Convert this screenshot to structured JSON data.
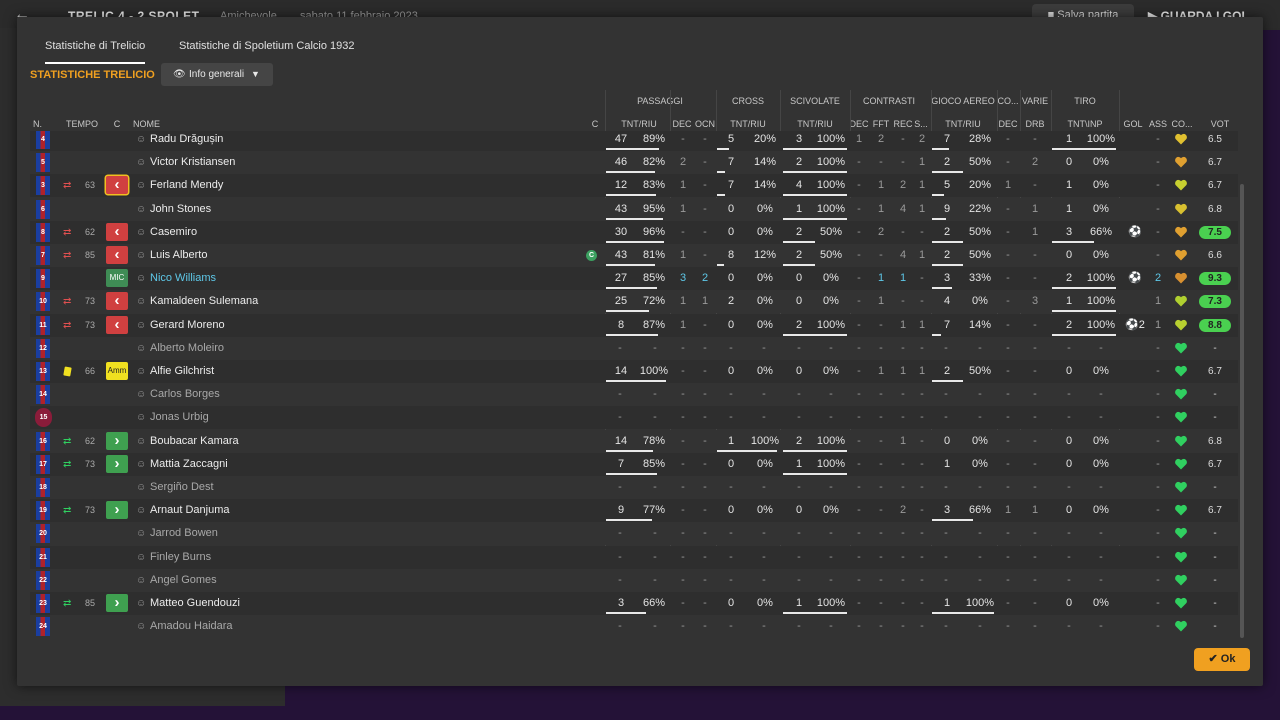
{
  "topbar": {
    "back_icon": "arrow-left-icon",
    "match": "TRELIC  4 - 2  SPOLET",
    "competition": "Amichevole",
    "date": "sabato 11 febbraio 2023",
    "save_label": "Salva partita",
    "watch_label": "GUARDA I GOL"
  },
  "tabs": [
    {
      "label": "Statistiche di Trelicio",
      "active": true
    },
    {
      "label": "Statistiche di Spoletium Calcio 1932",
      "active": false
    }
  ],
  "section_title": "STATISTICHE TRELICIO",
  "view_dropdown": {
    "label": "Info generali",
    "icon": "eye-icon"
  },
  "group_headers": [
    "PASSAGGI",
    "CROSS",
    "SCIVOLATE",
    "CONTRASTI",
    "GIOCO AEREO",
    "CO...",
    "VARIE",
    "TIRO"
  ],
  "column_headers": {
    "num": "N.",
    "time": "TEMPO",
    "c": "C",
    "name": "NOME",
    "c2": "C",
    "pass": "TNT/RIU",
    "dec": "DEC",
    "ocn": "OCN",
    "cross": "TNT/RIU",
    "tackle": "TNT/RIU",
    "cdec": "DEC",
    "fft": "FFT",
    "rec": "REC",
    "s": "S...",
    "aerial": "TNT/RIU",
    "codec": "DEC",
    "drb": "DRB",
    "shot": "TNT\\INP",
    "gol": "GOL",
    "ass": "ASS",
    "co": "CO...",
    "vot": "VOT"
  },
  "colors": {
    "accent": "#f0a020",
    "highlight": "#5ec8e8",
    "sub_out": "#d04040",
    "sub_in": "#3fa050"
  },
  "players": [
    {
      "num": "4",
      "name": "Radu Drăgușin",
      "status": "played",
      "sub": "",
      "min": "",
      "badge": "",
      "pass": [
        "47",
        "89%"
      ],
      "pass_frac": 0.89,
      "dec": "-",
      "ocn": "-",
      "cross": [
        "5",
        "20%"
      ],
      "cross_frac": 0.2,
      "tackle": [
        "3",
        "100%"
      ],
      "tackle_frac": 1,
      "cdec": "1",
      "fft": "2",
      "rec": "-",
      "s": "2",
      "aerial": [
        "7",
        "28%"
      ],
      "aerial_frac": 0.28,
      "codec": "-",
      "drb": "-",
      "shot": [
        "1",
        "100%"
      ],
      "shot_frac": 1,
      "gol": "",
      "ass": "-",
      "heart": "#e0c030",
      "rating": "6.5",
      "rating_style": "plain"
    },
    {
      "num": "5",
      "name": "Victor Kristiansen",
      "status": "played",
      "sub": "",
      "min": "",
      "badge": "",
      "pass": [
        "46",
        "82%"
      ],
      "pass_frac": 0.82,
      "dec": "2",
      "ocn": "-",
      "cross": [
        "7",
        "14%"
      ],
      "cross_frac": 0.14,
      "tackle": [
        "2",
        "100%"
      ],
      "tackle_frac": 1,
      "cdec": "-",
      "fft": "-",
      "rec": "-",
      "s": "1",
      "aerial": [
        "2",
        "50%"
      ],
      "aerial_frac": 0.5,
      "codec": "-",
      "drb": "2",
      "shot": [
        "0",
        "0%"
      ],
      "shot_frac": 0,
      "gol": "",
      "ass": "-",
      "heart": "#e0a030",
      "rating": "6.7",
      "rating_style": "plain"
    },
    {
      "num": "3",
      "name": "Ferland Mendy",
      "status": "played",
      "sub": "out",
      "min": "63",
      "badge": "red-sel",
      "pass": [
        "12",
        "83%"
      ],
      "pass_frac": 0.83,
      "dec": "1",
      "ocn": "-",
      "cross": [
        "7",
        "14%"
      ],
      "cross_frac": 0.14,
      "tackle": [
        "4",
        "100%"
      ],
      "tackle_frac": 1,
      "cdec": "-",
      "fft": "1",
      "rec": "2",
      "s": "1",
      "aerial": [
        "5",
        "20%"
      ],
      "aerial_frac": 0.2,
      "codec": "1",
      "drb": "-",
      "shot": [
        "1",
        "0%"
      ],
      "shot_frac": 0,
      "gol": "",
      "ass": "-",
      "heart": "#c8d030",
      "rating": "6.7",
      "rating_style": "plain"
    },
    {
      "num": "6",
      "name": "John Stones",
      "status": "played",
      "sub": "",
      "min": "",
      "badge": "",
      "pass": [
        "43",
        "95%"
      ],
      "pass_frac": 0.95,
      "dec": "1",
      "ocn": "-",
      "cross": [
        "0",
        "0%"
      ],
      "cross_frac": 0,
      "tackle": [
        "1",
        "100%"
      ],
      "tackle_frac": 1,
      "cdec": "-",
      "fft": "1",
      "rec": "4",
      "s": "1",
      "aerial": [
        "9",
        "22%"
      ],
      "aerial_frac": 0.22,
      "codec": "-",
      "drb": "1",
      "shot": [
        "1",
        "0%"
      ],
      "shot_frac": 0,
      "gol": "",
      "ass": "-",
      "heart": "#d8c030",
      "rating": "6.8",
      "rating_style": "plain"
    },
    {
      "num": "8",
      "name": "Casemiro",
      "status": "played",
      "sub": "out",
      "min": "62",
      "badge": "red",
      "pass": [
        "30",
        "96%"
      ],
      "pass_frac": 0.96,
      "dec": "-",
      "ocn": "-",
      "cross": [
        "0",
        "0%"
      ],
      "cross_frac": 0,
      "tackle": [
        "2",
        "50%"
      ],
      "tackle_frac": 0.5,
      "cdec": "-",
      "fft": "2",
      "rec": "-",
      "s": "-",
      "aerial": [
        "2",
        "50%"
      ],
      "aerial_frac": 0.5,
      "codec": "-",
      "drb": "1",
      "shot": [
        "3",
        "66%"
      ],
      "shot_frac": 0.66,
      "gol": "⚽",
      "ass": "-",
      "heart": "#e0a030",
      "rating": "7.5",
      "rating_style": "g2"
    },
    {
      "num": "7",
      "name": "Luis Alberto",
      "status": "played",
      "sub": "out",
      "min": "85",
      "badge": "red",
      "captain": true,
      "pass": [
        "43",
        "81%"
      ],
      "pass_frac": 0.81,
      "dec": "1",
      "ocn": "-",
      "cross": [
        "8",
        "12%"
      ],
      "cross_frac": 0.12,
      "tackle": [
        "2",
        "50%"
      ],
      "tackle_frac": 0.5,
      "cdec": "-",
      "fft": "-",
      "rec": "4",
      "s": "1",
      "aerial": [
        "2",
        "50%"
      ],
      "aerial_frac": 0.5,
      "codec": "-",
      "drb": "-",
      "shot": [
        "0",
        "0%"
      ],
      "shot_frac": 0,
      "gol": "",
      "ass": "-",
      "heart": "#e0a030",
      "rating": "6.6",
      "rating_style": "plain"
    },
    {
      "num": "9",
      "name": "Nico Williams",
      "status": "highlight",
      "sub": "",
      "min": "",
      "badge": "mic",
      "badge_text": "MIC",
      "pass": [
        "27",
        "85%"
      ],
      "pass_frac": 0.85,
      "dec": "3",
      "ocn": "2",
      "cross": [
        "0",
        "0%"
      ],
      "cross_frac": 0,
      "tackle": [
        "0",
        "0%"
      ],
      "tackle_frac": 0,
      "cdec": "-",
      "fft": "1",
      "rec": "1",
      "s": "-",
      "aerial": [
        "3",
        "33%"
      ],
      "aerial_frac": 0.33,
      "codec": "-",
      "drb": "-",
      "shot": [
        "2",
        "100%"
      ],
      "shot_frac": 1,
      "gol": "⚽",
      "ass": "2",
      "heart": "#d89030",
      "rating": "9.3",
      "rating_style": "g2"
    },
    {
      "num": "10",
      "name": "Kamaldeen Sulemana",
      "status": "played",
      "sub": "out",
      "min": "73",
      "badge": "red",
      "pass": [
        "25",
        "72%"
      ],
      "pass_frac": 0.72,
      "dec": "1",
      "ocn": "1",
      "cross": [
        "2",
        "0%"
      ],
      "cross_frac": 0,
      "tackle": [
        "0",
        "0%"
      ],
      "tackle_frac": 0,
      "cdec": "-",
      "fft": "1",
      "rec": "-",
      "s": "-",
      "aerial": [
        "4",
        "0%"
      ],
      "aerial_frac": 0,
      "codec": "-",
      "drb": "3",
      "shot": [
        "1",
        "100%"
      ],
      "shot_frac": 1,
      "gol": "",
      "ass": "1",
      "heart": "#b0d030",
      "rating": "7.3",
      "rating_style": "g2"
    },
    {
      "num": "11",
      "name": "Gerard Moreno",
      "status": "played",
      "sub": "out",
      "min": "73",
      "badge": "red",
      "pass": [
        "8",
        "87%"
      ],
      "pass_frac": 0.87,
      "dec": "1",
      "ocn": "-",
      "cross": [
        "0",
        "0%"
      ],
      "cross_frac": 0,
      "tackle": [
        "2",
        "100%"
      ],
      "tackle_frac": 1,
      "cdec": "-",
      "fft": "-",
      "rec": "1",
      "s": "1",
      "aerial": [
        "7",
        "14%"
      ],
      "aerial_frac": 0.14,
      "codec": "-",
      "drb": "-",
      "shot": [
        "2",
        "100%"
      ],
      "shot_frac": 1,
      "gol": "⚽2",
      "ass": "1",
      "heart": "#b8d030",
      "rating": "8.8",
      "rating_style": "g2"
    },
    {
      "num": "12",
      "name": "Alberto Moleiro",
      "status": "unused",
      "dash": true,
      "heart": "#30d060",
      "rating": "-",
      "rating_style": "plain"
    },
    {
      "num": "13",
      "name": "Alfie Gilchrist",
      "status": "played",
      "sub": "card",
      "min": "66",
      "badge": "amm",
      "badge_text": "Amm",
      "pass": [
        "14",
        "100%"
      ],
      "pass_frac": 1,
      "dec": "-",
      "ocn": "-",
      "cross": [
        "0",
        "0%"
      ],
      "cross_frac": 0,
      "tackle": [
        "0",
        "0%"
      ],
      "tackle_frac": 0,
      "cdec": "-",
      "fft": "1",
      "rec": "1",
      "s": "1",
      "aerial": [
        "2",
        "50%"
      ],
      "aerial_frac": 0.5,
      "codec": "-",
      "drb": "-",
      "shot": [
        "0",
        "0%"
      ],
      "shot_frac": 0,
      "gol": "",
      "ass": "-",
      "heart": "#30d060",
      "rating": "6.7",
      "rating_style": "plain"
    },
    {
      "num": "14",
      "name": "Carlos Borges",
      "status": "unused",
      "dash": true,
      "heart": "#30d060",
      "rating": "-",
      "rating_style": "plain"
    },
    {
      "num": "15",
      "name": "Jonas Urbig",
      "status": "unused",
      "gk": true,
      "dash": true,
      "heart": "#30d060",
      "rating": "-",
      "rating_style": "plain"
    },
    {
      "num": "16",
      "name": "Boubacar Kamara",
      "status": "played",
      "sub": "in",
      "min": "62",
      "badge": "green",
      "pass": [
        "14",
        "78%"
      ],
      "pass_frac": 0.78,
      "dec": "-",
      "ocn": "-",
      "cross": [
        "1",
        "100%"
      ],
      "cross_frac": 1,
      "tackle": [
        "2",
        "100%"
      ],
      "tackle_frac": 1,
      "cdec": "-",
      "fft": "-",
      "rec": "1",
      "s": "-",
      "aerial": [
        "0",
        "0%"
      ],
      "aerial_frac": 0,
      "codec": "-",
      "drb": "-",
      "shot": [
        "0",
        "0%"
      ],
      "shot_frac": 0,
      "gol": "",
      "ass": "-",
      "heart": "#30d060",
      "rating": "6.8",
      "rating_style": "plain"
    },
    {
      "num": "17",
      "name": "Mattia Zaccagni",
      "status": "played",
      "sub": "in",
      "min": "73",
      "badge": "green",
      "pass": [
        "7",
        "85%"
      ],
      "pass_frac": 0.85,
      "dec": "-",
      "ocn": "-",
      "cross": [
        "0",
        "0%"
      ],
      "cross_frac": 0,
      "tackle": [
        "1",
        "100%"
      ],
      "tackle_frac": 1,
      "cdec": "-",
      "fft": "-",
      "rec": "-",
      "s": "-",
      "aerial": [
        "1",
        "0%"
      ],
      "aerial_frac": 0,
      "codec": "-",
      "drb": "-",
      "shot": [
        "0",
        "0%"
      ],
      "shot_frac": 0,
      "gol": "",
      "ass": "-",
      "heart": "#30d060",
      "rating": "6.7",
      "rating_style": "plain"
    },
    {
      "num": "18",
      "name": "Sergiño Dest",
      "status": "unused",
      "dash": true,
      "heart": "#30d060",
      "rating": "-",
      "rating_style": "plain"
    },
    {
      "num": "19",
      "name": "Arnaut Danjuma",
      "status": "played",
      "sub": "in",
      "min": "73",
      "badge": "green",
      "pass": [
        "9",
        "77%"
      ],
      "pass_frac": 0.77,
      "dec": "-",
      "ocn": "-",
      "cross": [
        "0",
        "0%"
      ],
      "cross_frac": 0,
      "tackle": [
        "0",
        "0%"
      ],
      "tackle_frac": 0,
      "cdec": "-",
      "fft": "-",
      "rec": "2",
      "s": "-",
      "aerial": [
        "3",
        "66%"
      ],
      "aerial_frac": 0.66,
      "codec": "1",
      "drb": "1",
      "shot": [
        "0",
        "0%"
      ],
      "shot_frac": 0,
      "gol": "",
      "ass": "-",
      "heart": "#30d060",
      "rating": "6.7",
      "rating_style": "plain"
    },
    {
      "num": "20",
      "name": "Jarrod Bowen",
      "status": "unused",
      "dash": true,
      "heart": "#30d060",
      "rating": "-",
      "rating_style": "plain"
    },
    {
      "num": "21",
      "name": "Finley Burns",
      "status": "unused",
      "dash": true,
      "heart": "#30d060",
      "rating": "-",
      "rating_style": "plain"
    },
    {
      "num": "22",
      "name": "Angel Gomes",
      "status": "unused",
      "dash": true,
      "heart": "#30d060",
      "rating": "-",
      "rating_style": "plain"
    },
    {
      "num": "23",
      "name": "Matteo Guendouzi",
      "status": "played",
      "sub": "in",
      "min": "85",
      "badge": "green",
      "pass": [
        "3",
        "66%"
      ],
      "pass_frac": 0.66,
      "dec": "-",
      "ocn": "-",
      "cross": [
        "0",
        "0%"
      ],
      "cross_frac": 0,
      "tackle": [
        "1",
        "100%"
      ],
      "tackle_frac": 1,
      "cdec": "-",
      "fft": "-",
      "rec": "-",
      "s": "-",
      "aerial": [
        "1",
        "100%"
      ],
      "aerial_frac": 1,
      "codec": "-",
      "drb": "-",
      "shot": [
        "0",
        "0%"
      ],
      "shot_frac": 0,
      "gol": "",
      "ass": "-",
      "heart": "#30d060",
      "rating": "-",
      "rating_style": "plain"
    },
    {
      "num": "24",
      "name": "Amadou Haidara",
      "status": "unused",
      "dash": true,
      "heart": "#30d060",
      "rating": "-",
      "rating_style": "plain"
    }
  ],
  "ok_label": "Ok",
  "ok_icon": "check-icon"
}
